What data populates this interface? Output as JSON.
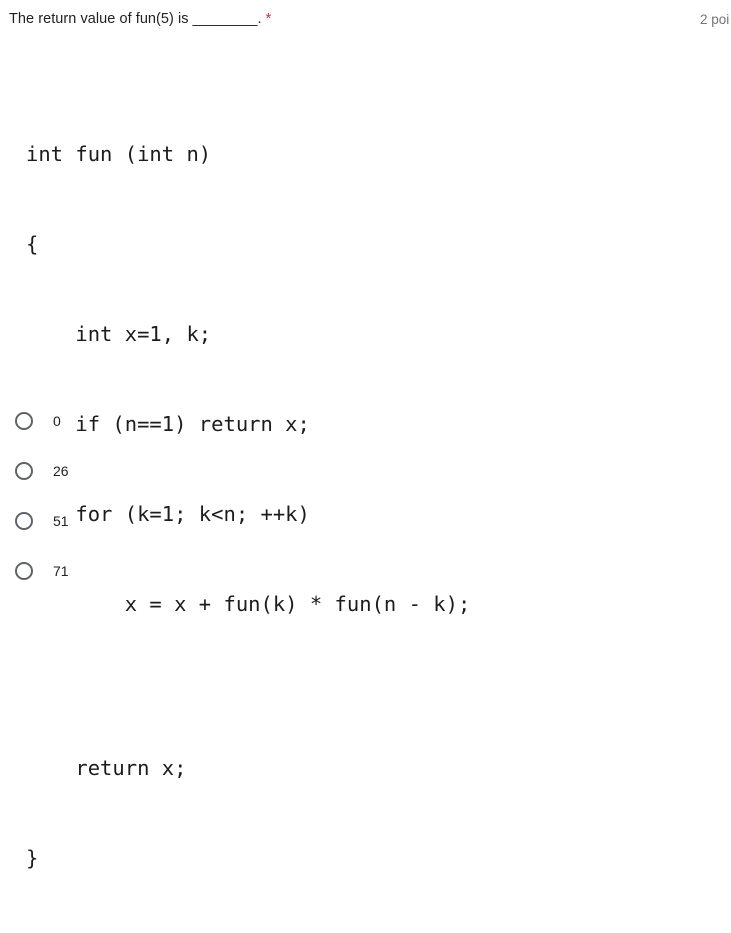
{
  "question": {
    "title": "The return value of fun(5) is ________.",
    "required_marker": "*",
    "points": "2 poi"
  },
  "code": {
    "lines": [
      "int fun (int n)",
      "{",
      "    int x=1, k;",
      "    if (n==1) return x;",
      "    for (k=1; k<n; ++k)",
      "        x = x + fun(k) * fun(n - k);",
      "",
      "    return x;",
      "}"
    ]
  },
  "options": [
    {
      "label": "0",
      "selected": false
    },
    {
      "label": "26",
      "selected": false
    },
    {
      "label": "51",
      "selected": false
    },
    {
      "label": "71",
      "selected": false
    }
  ],
  "colors": {
    "text": "#202124",
    "muted": "#70757a",
    "required": "#d93025",
    "radio_border": "#5f6368",
    "background": "#ffffff"
  }
}
